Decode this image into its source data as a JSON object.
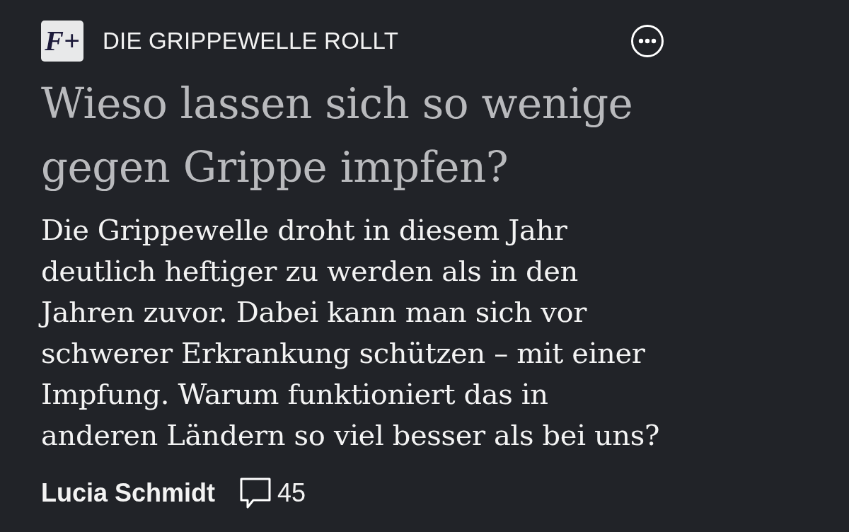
{
  "header": {
    "logo": "F+",
    "kicker": "DIE GRIPPEWELLE ROLLT"
  },
  "headline": "Wieso lassen sich so wenige gegen Grippe impfen?",
  "teaser": "Die Grippewelle droht in diesem Jahr deutlich heftiger zu werden als in den Jahren zuvor. Dabei kann man sich vor schwerer Erkrankung schützen – mit einer Impfung. Warum funktioniert das in anderen Ländern so viel besser als bei uns?",
  "byline": {
    "author": "Lucia Schmidt",
    "comment_count": "45"
  }
}
